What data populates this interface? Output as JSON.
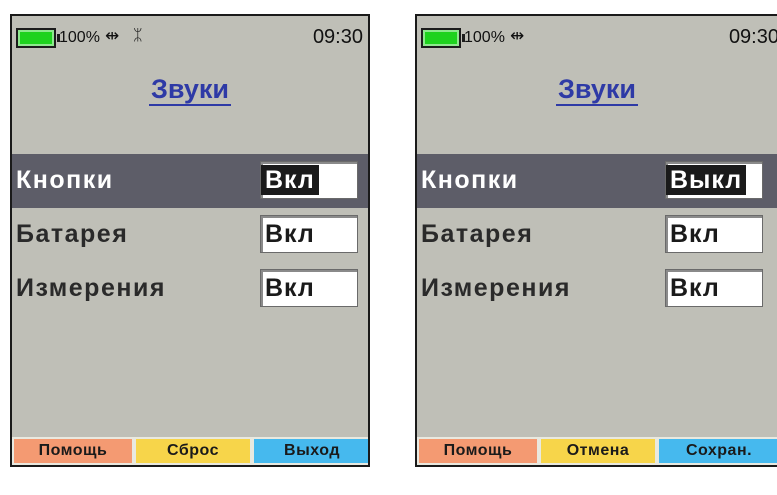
{
  "colors": {
    "screen_bg": "#bfbfb7",
    "title": "#2e3aa6",
    "selected_row": "#5d5d68",
    "battery": "#1ed21e",
    "softkey_help": "#f49a72",
    "softkey_middle": "#f7d54a",
    "softkey_right": "#46b9ee"
  },
  "left_screen": {
    "status": {
      "battery_pct": "100%",
      "usb_icon": "usb-icon",
      "bt_icon": "bluetooth-off-icon",
      "usb_glyph": "⇹",
      "bt_glyph": "ᛯ",
      "time": "09:30"
    },
    "title": "Звуки",
    "rows": [
      {
        "label": "Кнопки",
        "value": "Вкл"
      },
      {
        "label": "Батарея",
        "value": "Вкл"
      },
      {
        "label": "Измерения",
        "value": "Вкл"
      }
    ],
    "softkeys": {
      "left": "Помощь",
      "middle": "Сброс",
      "right": "Выход"
    }
  },
  "right_screen": {
    "status": {
      "battery_pct": "100%",
      "usb_icon": "usb-icon",
      "usb_glyph": "⇹",
      "time": "09:30"
    },
    "title": "Звуки",
    "rows": [
      {
        "label": "Кнопки",
        "value": "Выкл"
      },
      {
        "label": "Батарея",
        "value": "Вкл"
      },
      {
        "label": "Измерения",
        "value": "Вкл"
      }
    ],
    "softkeys": {
      "left": "Помощь",
      "middle": "Отмена",
      "right": "Сохран."
    }
  }
}
